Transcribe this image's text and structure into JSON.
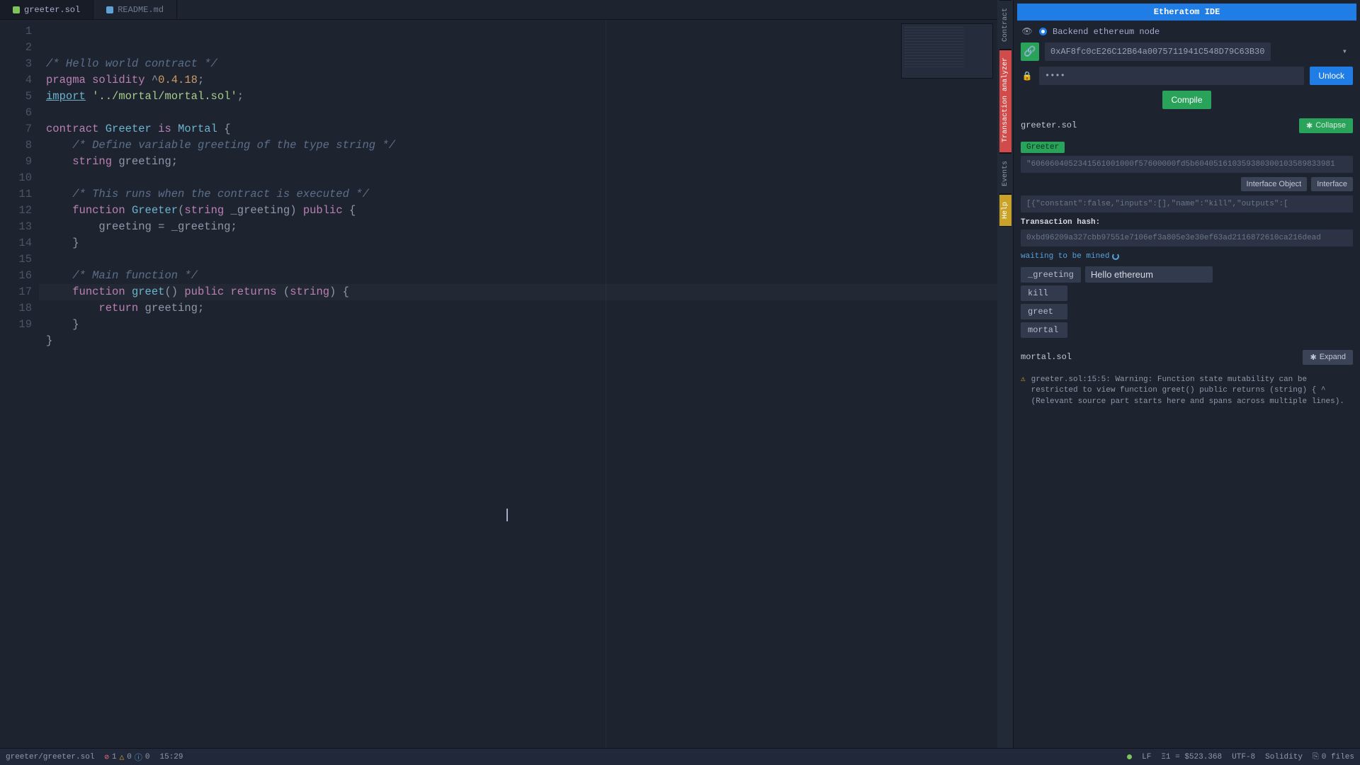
{
  "tabs": [
    {
      "label": "greeter.sol",
      "active": true,
      "icon": "green"
    },
    {
      "label": "README.md",
      "active": false,
      "icon": "blue"
    }
  ],
  "code": {
    "lines": [
      {
        "n": 1,
        "tokens": [
          [
            "com",
            "/* Hello world contract */"
          ]
        ]
      },
      {
        "n": 2,
        "tokens": [
          [
            "kw",
            "pragma"
          ],
          [
            "punc",
            " "
          ],
          [
            "kw",
            "solidity"
          ],
          [
            "punc",
            " ^"
          ],
          [
            "num",
            "0.4.18"
          ],
          [
            "punc",
            ";"
          ]
        ]
      },
      {
        "n": 3,
        "bp": true,
        "tokens": [
          [
            "import",
            "import"
          ],
          [
            "punc",
            " "
          ],
          [
            "str",
            "'../mortal/mortal.sol'"
          ],
          [
            "punc",
            ";"
          ]
        ]
      },
      {
        "n": 4,
        "tokens": []
      },
      {
        "n": 5,
        "tokens": [
          [
            "kw",
            "contract"
          ],
          [
            "punc",
            " "
          ],
          [
            "name",
            "Greeter"
          ],
          [
            "punc",
            " "
          ],
          [
            "kw",
            "is"
          ],
          [
            "punc",
            " "
          ],
          [
            "name",
            "Mortal"
          ],
          [
            "punc",
            " {"
          ]
        ]
      },
      {
        "n": 6,
        "indent": 1,
        "tokens": [
          [
            "com",
            "/* Define variable greeting of the type string */"
          ]
        ]
      },
      {
        "n": 7,
        "indent": 1,
        "tokens": [
          [
            "type",
            "string"
          ],
          [
            "punc",
            " greeting;"
          ]
        ]
      },
      {
        "n": 8,
        "tokens": []
      },
      {
        "n": 9,
        "indent": 1,
        "tokens": [
          [
            "com",
            "/* This runs when the contract is executed */"
          ]
        ]
      },
      {
        "n": 10,
        "indent": 1,
        "tokens": [
          [
            "kw",
            "function"
          ],
          [
            "punc",
            " "
          ],
          [
            "fn",
            "Greeter"
          ],
          [
            "punc",
            "("
          ],
          [
            "type",
            "string"
          ],
          [
            "punc",
            " _greeting) "
          ],
          [
            "kw",
            "public"
          ],
          [
            "punc",
            " {"
          ]
        ]
      },
      {
        "n": 11,
        "indent": 2,
        "tokens": [
          [
            "punc",
            "greeting = _greeting;"
          ]
        ]
      },
      {
        "n": 12,
        "indent": 1,
        "tokens": [
          [
            "punc",
            "}"
          ]
        ]
      },
      {
        "n": 13,
        "tokens": []
      },
      {
        "n": 14,
        "indent": 1,
        "tokens": [
          [
            "com",
            "/* Main function */"
          ]
        ]
      },
      {
        "n": 15,
        "indent": 1,
        "hl": true,
        "tokens": [
          [
            "kw",
            "function"
          ],
          [
            "punc",
            " "
          ],
          [
            "fn",
            "greet"
          ],
          [
            "punc",
            "() "
          ],
          [
            "kw",
            "public"
          ],
          [
            "punc",
            " "
          ],
          [
            "kw",
            "returns"
          ],
          [
            "punc",
            " ("
          ],
          [
            "type",
            "string"
          ],
          [
            "punc",
            ") {"
          ]
        ]
      },
      {
        "n": 16,
        "indent": 2,
        "tokens": [
          [
            "kw",
            "return"
          ],
          [
            "punc",
            " greeting;"
          ]
        ]
      },
      {
        "n": 17,
        "indent": 1,
        "tokens": [
          [
            "punc",
            "}"
          ]
        ]
      },
      {
        "n": 18,
        "tokens": [
          [
            "punc",
            "}"
          ]
        ]
      },
      {
        "n": 19,
        "tokens": []
      }
    ]
  },
  "dock": {
    "contract": "Contract",
    "tx": "Transaction analyzer",
    "events": "Events",
    "help": "Help"
  },
  "panel": {
    "title": "Etheratom IDE",
    "backend_label": "Backend ethereum node",
    "account": "0xAF8fc0cE26C12B64a0075711941C548D79C63B30",
    "password_mask": "●●●●",
    "unlock": "Unlock",
    "compile": "Compile",
    "file1": "greeter.sol",
    "collapse": "Collapse",
    "contract_name": "Greeter",
    "bytecode": "\"6060604052341561001000f57600000fd5b604051610359380300103589833981",
    "interface_object": "Interface Object",
    "interface": "Interface",
    "abi": "[{\"constant\":false,\"inputs\":[],\"name\":\"kill\",\"outputs\":[",
    "tx_hash_label": "Transaction hash:",
    "tx_hash": "0xbd96209a327cbb97551e7106ef3a805e3e30ef63ad2116872610ca216dead",
    "mined": "waiting to be mined",
    "greeting_param": "_greeting",
    "greeting_value": "Hello ethereum",
    "fns": [
      "kill",
      "greet",
      "mortal"
    ],
    "file2": "mortal.sol",
    "expand": "Expand",
    "warning": "greeter.sol:15:5: Warning: Function state mutability can be restricted to view function greet() public returns (string) { ^ (Relevant source part starts here and spans across multiple lines)."
  },
  "status": {
    "path": "greeter/greeter.sol",
    "err": "1",
    "warn": "0",
    "info": "0",
    "pos": "15:29",
    "lf": "LF",
    "balance": "Ξ1 = $523.368",
    "enc": "UTF-8",
    "lang": "Solidity",
    "files": "0 files"
  }
}
